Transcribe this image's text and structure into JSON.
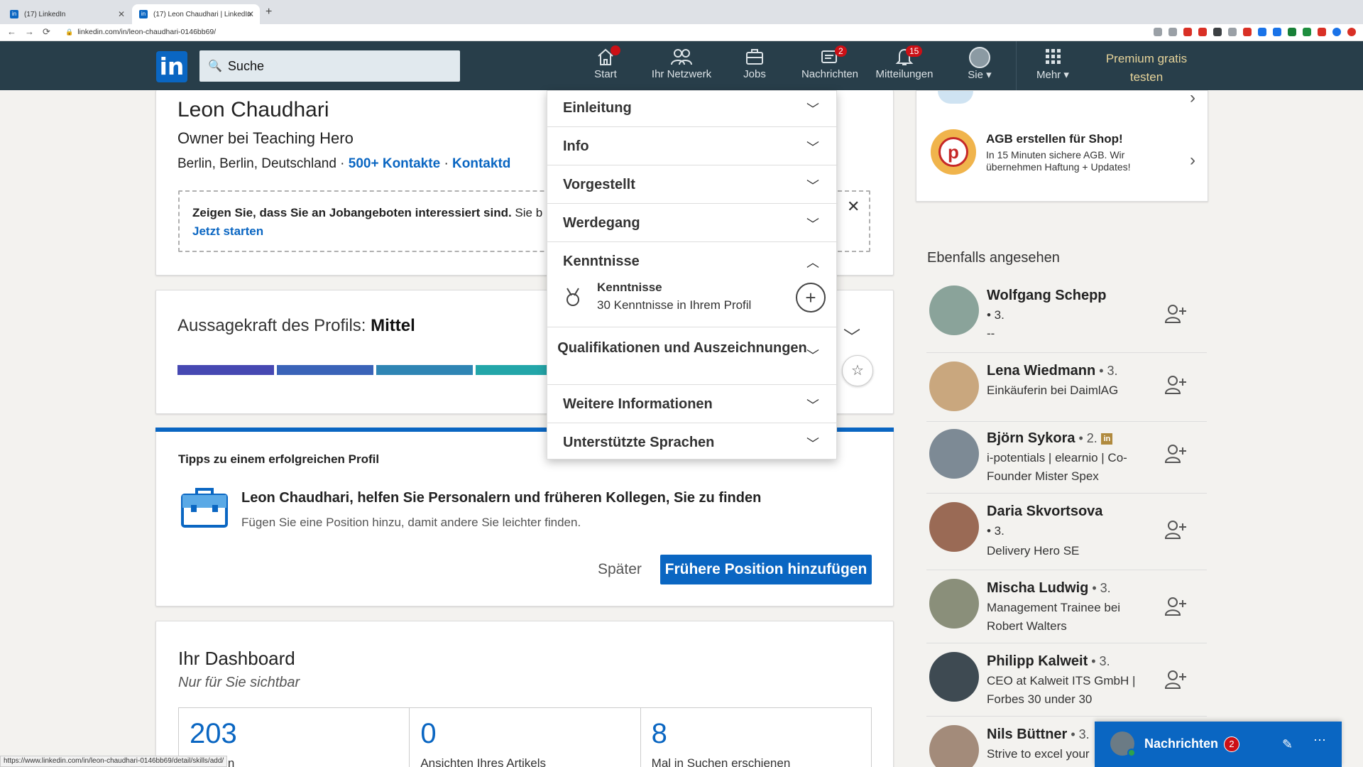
{
  "browser": {
    "tabs": [
      {
        "label": "(17) LinkedIn"
      },
      {
        "label": "(17) Leon Chaudhari | LinkedIn"
      }
    ],
    "url": "linkedin.com/in/leon-chaudhari-0146bb69/",
    "status_url": "https://www.linkedin.com/in/leon-chaudhari-0146bb69/detail/skills/add/"
  },
  "header": {
    "logo": "in",
    "search_label": "Suche",
    "nav": [
      {
        "label": "Start",
        "badge": "•"
      },
      {
        "label": "Ihr Netzwerk",
        "badge": ""
      },
      {
        "label": "Jobs",
        "badge": ""
      },
      {
        "label": "Nachrichten",
        "badge": "2"
      },
      {
        "label": "Mitteilungen",
        "badge": "15"
      },
      {
        "label": "Sie",
        "badge": ""
      },
      {
        "label": "Mehr",
        "badge": ""
      }
    ],
    "premium_line1": "Premium gratis",
    "premium_line2": "testen"
  },
  "profile": {
    "name": "Leon Chaudhari",
    "headline": "Owner bei Teaching Hero",
    "location": "Berlin, Berlin, Deutschland",
    "contacts": "500+ Kontakte",
    "contact_info": "Kontaktd",
    "job_prompt": "Zeigen Sie, dass Sie an Jobangeboten interessiert sind.",
    "job_prompt_rest": " Sie b",
    "job_link": "Jetzt starten"
  },
  "strength": {
    "label": "Aussagekraft des Profils:",
    "level": "Mittel",
    "segments_filled": 4,
    "segments_colors": [
      "#4648b2",
      "#3a63b8",
      "#2f85b4",
      "#23a6a9"
    ]
  },
  "tips": {
    "title": "Tipps zu einem erfolgreichen Profil",
    "main": "Leon Chaudhari, helfen Sie Personalern und früheren Kollegen, Sie zu finden",
    "sub": "Fügen Sie eine Position hinzu, damit andere Sie leichter finden.",
    "later": "Später",
    "primary": "Frühere Position hinzufügen"
  },
  "dashboard": {
    "title": "Ihr Dashboard",
    "subtitle": "Nur für Sie sichtbar",
    "stats": [
      {
        "value": "203",
        "label": "nsichten"
      },
      {
        "value": "0",
        "label": "Ansichten Ihres Artikels"
      },
      {
        "value": "8",
        "label": "Mal in Suchen erschienen"
      }
    ]
  },
  "dropdown": {
    "items": [
      {
        "label": "Einleitung"
      },
      {
        "label": "Info"
      },
      {
        "label": "Vorgestellt"
      },
      {
        "label": "Werdegang"
      },
      {
        "label": "Kenntnisse"
      },
      {
        "label": "Qualifikationen und Auszeichnungen"
      },
      {
        "label": "Weitere Informationen"
      },
      {
        "label": "Unterstützte Sprachen"
      }
    ],
    "skills_title": "Kenntnisse",
    "skills_sub": "30 Kenntnisse in Ihrem Profil"
  },
  "ad": {
    "logo_letter": "p",
    "title": "AGB erstellen für Shop!",
    "text": "In 15 Minuten sichere AGB. Wir übernehmen Haftung + Updates!"
  },
  "also_viewed": {
    "title": "Ebenfalls angesehen",
    "people": [
      {
        "name": "Wolfgang Schepp",
        "degree": "",
        "line1": "• 3.",
        "line2": "--"
      },
      {
        "name": "Lena Wiedmann",
        "degree": " • 3.",
        "line1": "Einkäuferin bei DaimlAG",
        "line2": ""
      },
      {
        "name": "Björn Sykora",
        "degree": " • 2.",
        "line1": "i-potentials | elearnio | Co-Founder Mister Spex",
        "line2": ""
      },
      {
        "name": "Daria Skvortsova",
        "degree": "",
        "line1": "• 3.",
        "line2": "Delivery Hero SE"
      },
      {
        "name": "Mischa Ludwig",
        "degree": " • 3.",
        "line1": "Management Trainee bei Robert Walters",
        "line2": ""
      },
      {
        "name": "Philipp Kalweit",
        "degree": " • 3.",
        "line1": "CEO at Kalweit ITS GmbH | Forbes 30 under 30",
        "line2": ""
      },
      {
        "name": "Nils Büttner",
        "degree": " • 3.",
        "line1": "Strive to excel your",
        "line2": ""
      }
    ]
  },
  "messaging": {
    "label": "Nachrichten",
    "badge": "2"
  }
}
